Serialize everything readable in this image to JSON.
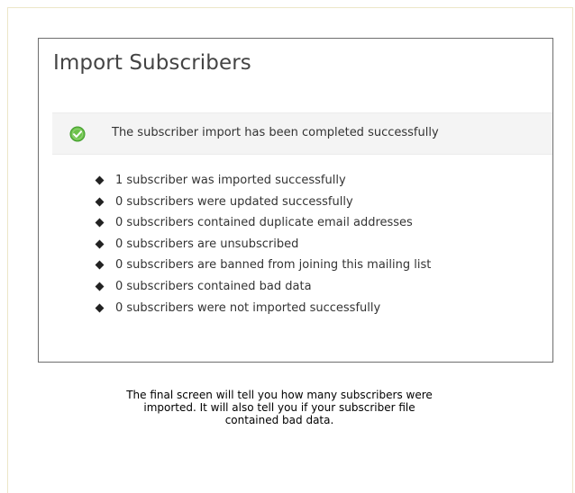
{
  "panel": {
    "title": "Import Subscribers",
    "success_message": "The subscriber import has been completed successfully",
    "success_icon": "check-circle-icon",
    "success_color": "#5cb85c"
  },
  "results": [
    "1 subscriber was imported successfully",
    "0 subscribers were updated successfully",
    "0 subscribers contained duplicate email addresses",
    "0 subscribers are unsubscribed",
    "0 subscribers are banned from joining this mailing list",
    "0 subscribers contained bad data",
    "0 subscribers were not imported successfully"
  ],
  "caption": {
    "line1": "The final screen will tell you how many subscribers were",
    "line2": "imported. It will also tell you if your subscriber file",
    "line3": "contained bad data."
  }
}
